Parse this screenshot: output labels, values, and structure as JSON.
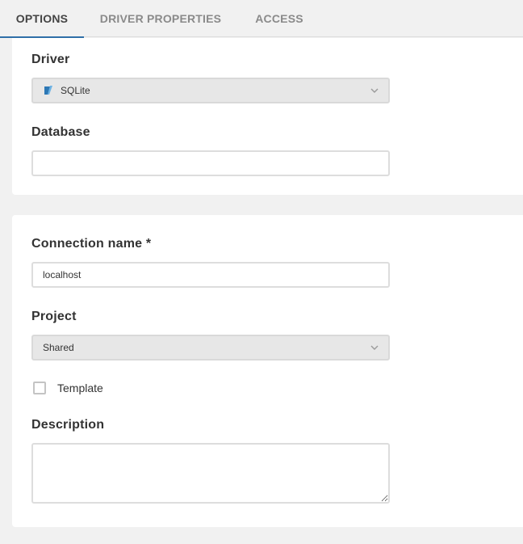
{
  "tabs": [
    {
      "label": "OPTIONS",
      "active": true
    },
    {
      "label": "DRIVER PROPERTIES",
      "active": false
    },
    {
      "label": "ACCESS",
      "active": false
    }
  ],
  "driver": {
    "label": "Driver",
    "selected": "SQLite",
    "icon": "sqlite-icon"
  },
  "database": {
    "label": "Database",
    "value": ""
  },
  "connection_name": {
    "label": "Connection name *",
    "value": "localhost"
  },
  "project": {
    "label": "Project",
    "selected": "Shared"
  },
  "template": {
    "label": "Template",
    "checked": false
  },
  "description": {
    "label": "Description",
    "value": ""
  },
  "colors": {
    "accent": "#2f6fa8",
    "background": "#f1f1f1",
    "card": "#ffffff"
  }
}
